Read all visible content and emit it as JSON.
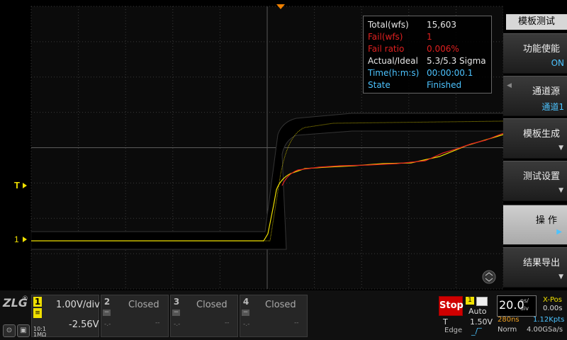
{
  "stats": {
    "rows": [
      {
        "label": "Total(wfs)",
        "value": "15,603",
        "color": "#e6e6e6"
      },
      {
        "label": "Fail(wfs)",
        "value": "1",
        "color": "#e02020"
      },
      {
        "label": "Fail  ratio",
        "value": "0.006%",
        "color": "#e02020"
      },
      {
        "label": "Actual/Ideal",
        "value": "5.3/5.3  Sigma",
        "color": "#e6e6e6"
      },
      {
        "label": "Time(h:m:s)",
        "value": "00:00:00.1",
        "color": "#4cc3ff"
      },
      {
        "label": "State",
        "value": "Finished",
        "color": "#4cc3ff"
      }
    ]
  },
  "markers": {
    "trigger": "T",
    "channel1": "1"
  },
  "menu": {
    "title": "模板测试",
    "function_enable": {
      "label": "功能使能",
      "value": "ON"
    },
    "channel_source": {
      "label": "通道源",
      "value": "通道1"
    },
    "template_generate": {
      "label": "模板生成"
    },
    "test_settings": {
      "label": "测试设置"
    },
    "operation": {
      "label": "操 作"
    },
    "export_results": {
      "label": "结果导出"
    }
  },
  "channels": {
    "ch1": {
      "num": "1",
      "scale": "1.00V/div",
      "offset": "-2.56V",
      "impedance_top": "10:1",
      "impedance_bot": "1MΩ"
    },
    "ch2": {
      "num": "2",
      "status": "Closed",
      "small_left": "-.-",
      "small_right": "--"
    },
    "ch3": {
      "num": "3",
      "status": "Closed",
      "small_left": "-.-",
      "small_right": "--"
    },
    "ch4": {
      "num": "4",
      "status": "Closed",
      "small_left": "-.-",
      "small_right": "--"
    }
  },
  "logo": {
    "text": "ZLG",
    "reg": "®"
  },
  "trigger": {
    "run_state": "Stop",
    "source": "1",
    "mode": "Auto",
    "label": "T",
    "level": "1.50V",
    "type": "Edge"
  },
  "timebase": {
    "value": "20.0",
    "unit_top": "ns/",
    "unit_bottom": "div",
    "xpos_label": "X-Pos",
    "xpos_value": "0.00s",
    "record_length": "280ns",
    "points": "1.12Kpts",
    "acq_mode": "Norm",
    "sample_rate": "4.00GSa/s"
  },
  "colors": {
    "ch1_yellow": "#f0e000",
    "fail_red": "#e02020",
    "info_blue": "#4cc3ff",
    "stop_red": "#d00000",
    "grid": "#3a3a3a"
  }
}
